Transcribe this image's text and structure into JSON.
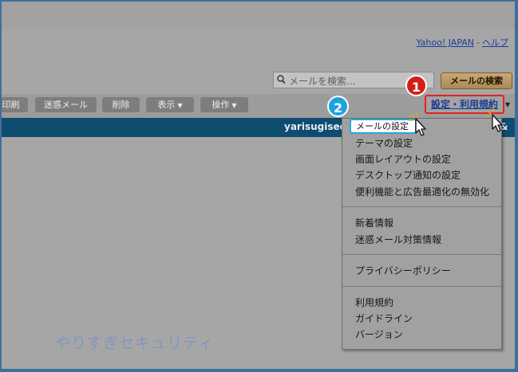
{
  "header": {
    "yahoo_link": "Yahoo! JAPAN",
    "separator": "-",
    "help_link": "ヘルプ"
  },
  "search": {
    "placeholder": "メールを検索...",
    "button_label": "メールの検索"
  },
  "toolbar": {
    "buttons": [
      {
        "label": "印刷"
      },
      {
        "label": "迷惑メール"
      },
      {
        "label": "削除"
      },
      {
        "label": "表示"
      },
      {
        "label": "操作"
      }
    ],
    "settings_link": "設定・利用規約"
  },
  "account": {
    "username": "yarisugisecurity",
    "username_tail": "&"
  },
  "settings_menu": {
    "group1": [
      {
        "label": "メールの設定"
      },
      {
        "label": "テーマの設定"
      },
      {
        "label": "画面レイアウトの設定"
      },
      {
        "label": "デスクトップ通知の設定"
      },
      {
        "label": "便利機能と広告最適化の無効化"
      }
    ],
    "group2": [
      {
        "label": "新着情報"
      },
      {
        "label": "迷惑メール対策情報"
      }
    ],
    "group3": [
      {
        "label": "プライバシーポリシー"
      }
    ],
    "group4": [
      {
        "label": "利用規約"
      },
      {
        "label": "ガイドライン"
      },
      {
        "label": "バージョン"
      }
    ]
  },
  "annotations": {
    "step1": "1",
    "step2": "2"
  },
  "watermark": "やりすぎセキュリティ",
  "colors": {
    "outer_border": "#3e6e9c",
    "dim_background": "#a6a6a6",
    "account_bar": "#0e4c70",
    "highlight_red": "#e4231f",
    "highlight_blue": "#2aa5dd",
    "badge_red": "#d31d18",
    "badge_blue": "#1ba3e0"
  }
}
